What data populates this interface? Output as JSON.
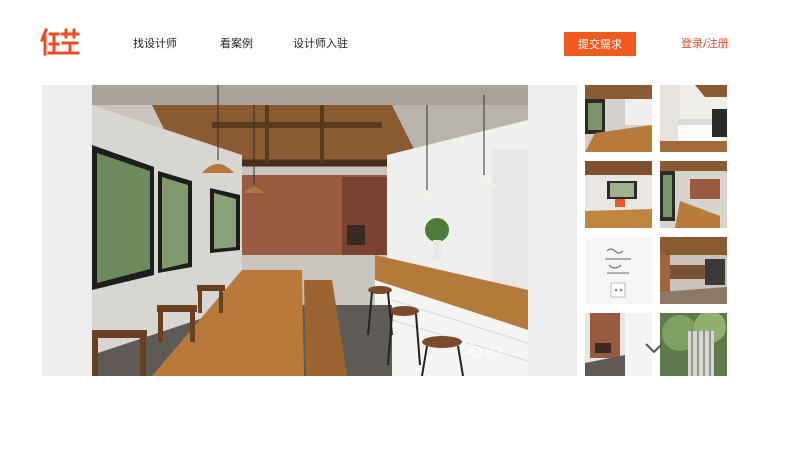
{
  "logo": {
    "icon": "brand-logo"
  },
  "nav": {
    "items": [
      {
        "label": "找设计师"
      },
      {
        "label": "看案例"
      },
      {
        "label": "设计师入驻"
      }
    ]
  },
  "header": {
    "cta_label": "提交需求",
    "auth_label": "登录/注册",
    "accent_color": "#ef5a1e"
  },
  "gallery": {
    "main_photo": {
      "subject": "loft-cafe-interior",
      "watermark_icon": "wechat-icon",
      "watermark_text": "住艺"
    },
    "thumbnails": [
      {
        "subject": "cafe-bar-counter"
      },
      {
        "subject": "bedroom"
      },
      {
        "subject": "dining-area"
      },
      {
        "subject": "living-room"
      },
      {
        "subject": "wall-sketch"
      },
      {
        "subject": "lounge-sofa"
      },
      {
        "subject": "brick-wall-corner"
      },
      {
        "subject": "garden-door"
      }
    ],
    "scroll_icon": "chevron-down-icon"
  }
}
